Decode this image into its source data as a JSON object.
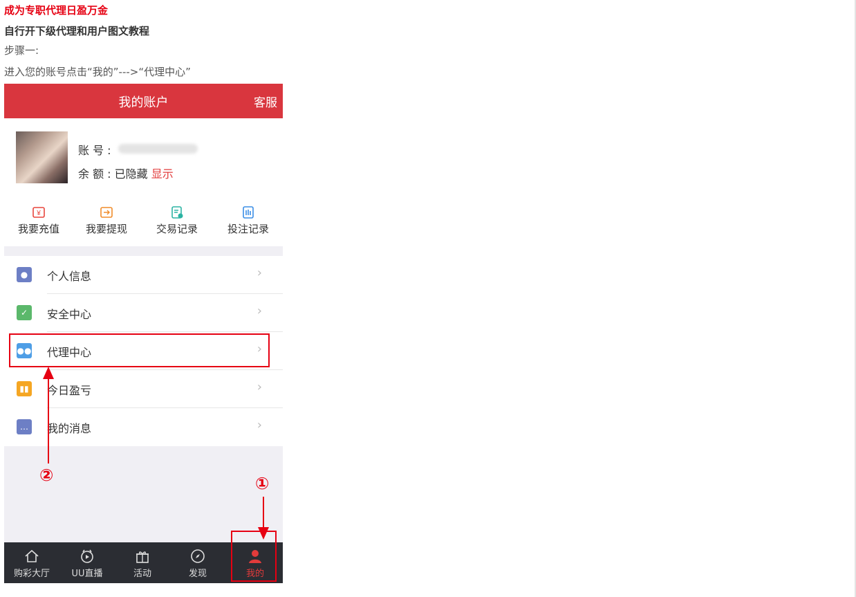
{
  "doc": {
    "title": "成为专职代理日盈万金",
    "subtitle": "自行开下级代理和用户图文教程",
    "step": "步骤一:",
    "instruction": "进入您的账号点击“我的”--->“代理中心”"
  },
  "phone": {
    "header": {
      "title": "我的账户",
      "service": "客服"
    },
    "account": {
      "no_label": "账 号 :",
      "bal_label": "余 额 : 已隐藏",
      "show_link": "显示"
    },
    "quick": [
      {
        "label": "我要充值",
        "icon": "recharge-icon",
        "color": "#e8453c"
      },
      {
        "label": "我要提现",
        "icon": "withdraw-icon",
        "color": "#f08c2a"
      },
      {
        "label": "交易记录",
        "icon": "transaction-record-icon",
        "color": "#2bb3a3"
      },
      {
        "label": "投注记录",
        "icon": "bet-record-icon",
        "color": "#3a8ee6"
      }
    ],
    "menu": [
      {
        "label": "个人信息",
        "icon": "person-icon",
        "color": "#6d7fc5"
      },
      {
        "label": "安全中心",
        "icon": "shield-icon",
        "color": "#5bb86b"
      },
      {
        "label": "代理中心",
        "icon": "agent-icon",
        "color": "#4e9ee6"
      },
      {
        "label": "今日盈亏",
        "icon": "bar-chart-icon",
        "color": "#f5a623"
      },
      {
        "label": "我的消息",
        "icon": "message-icon",
        "color": "#6d7fc5"
      }
    ],
    "tabs": [
      {
        "label": "购彩大厅",
        "icon": "home-icon"
      },
      {
        "label": "UU直播",
        "icon": "live-icon"
      },
      {
        "label": "活动",
        "icon": "gift-icon"
      },
      {
        "label": "发现",
        "icon": "compass-icon"
      },
      {
        "label": "我的",
        "icon": "user-icon"
      }
    ]
  },
  "annotations": {
    "one": "①",
    "two": "②"
  },
  "colors": {
    "accent": "#d9363e",
    "annotation": "#e60012"
  }
}
